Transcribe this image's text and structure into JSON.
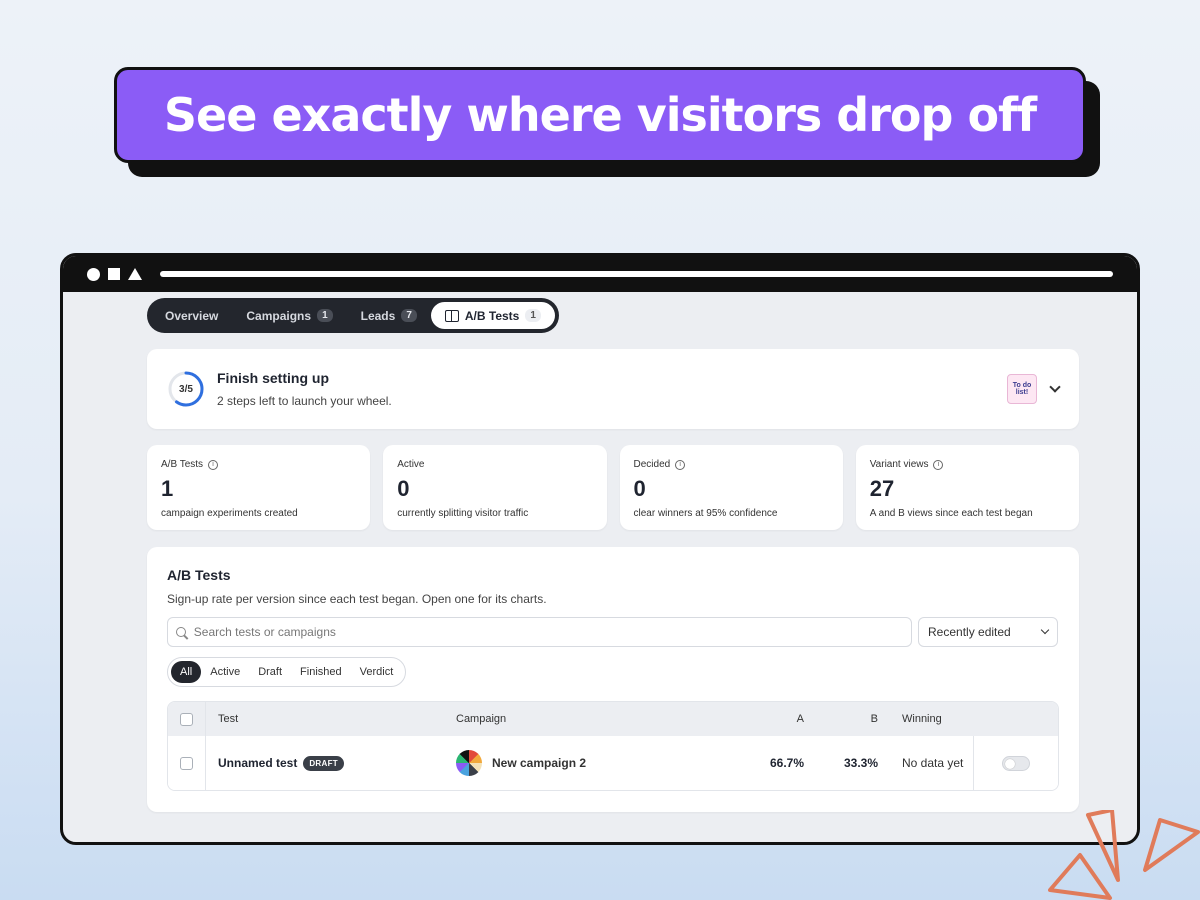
{
  "headline": "See exactly where visitors drop off",
  "tabs": [
    {
      "label": "Overview",
      "count": null
    },
    {
      "label": "Campaigns",
      "count": "1"
    },
    {
      "label": "Leads",
      "count": "7"
    },
    {
      "label": "A/B Tests",
      "count": "1",
      "active": true
    }
  ],
  "setup": {
    "progress": "3/5",
    "progress_fraction": 0.6,
    "title": "Finish setting up",
    "subtitle": "2 steps left to launch your wheel.",
    "todo_icon_text": "To do list!"
  },
  "stats": [
    {
      "label": "A/B Tests",
      "value": "1",
      "desc": "campaign experiments created",
      "info": true
    },
    {
      "label": "Active",
      "value": "0",
      "desc": "currently splitting visitor traffic",
      "info": false
    },
    {
      "label": "Decided",
      "value": "0",
      "desc": "clear winners at 95% confidence",
      "info": true
    },
    {
      "label": "Variant views",
      "value": "27",
      "desc": "A and B views since each test began",
      "info": true
    }
  ],
  "tests": {
    "title": "A/B Tests",
    "subtitle": "Sign-up rate per version since each test began. Open one for its charts.",
    "search_placeholder": "Search tests or campaigns",
    "sort_value": "Recently edited",
    "filters": [
      "All",
      "Active",
      "Draft",
      "Finished",
      "Verdict"
    ],
    "active_filter": "All",
    "columns": {
      "test": "Test",
      "campaign": "Campaign",
      "a": "A",
      "b": "B",
      "winning": "Winning"
    },
    "rows": [
      {
        "test": "Unnamed test",
        "status": "DRAFT",
        "campaign": "New campaign 2",
        "a": "66.7%",
        "b": "33.3%",
        "winning": "No data yet",
        "enabled": false
      }
    ]
  },
  "colors": {
    "accent": "#8b5cf6",
    "progress": "#2f6fdf",
    "dark": "#23262d",
    "deco": "#e07b5a"
  }
}
